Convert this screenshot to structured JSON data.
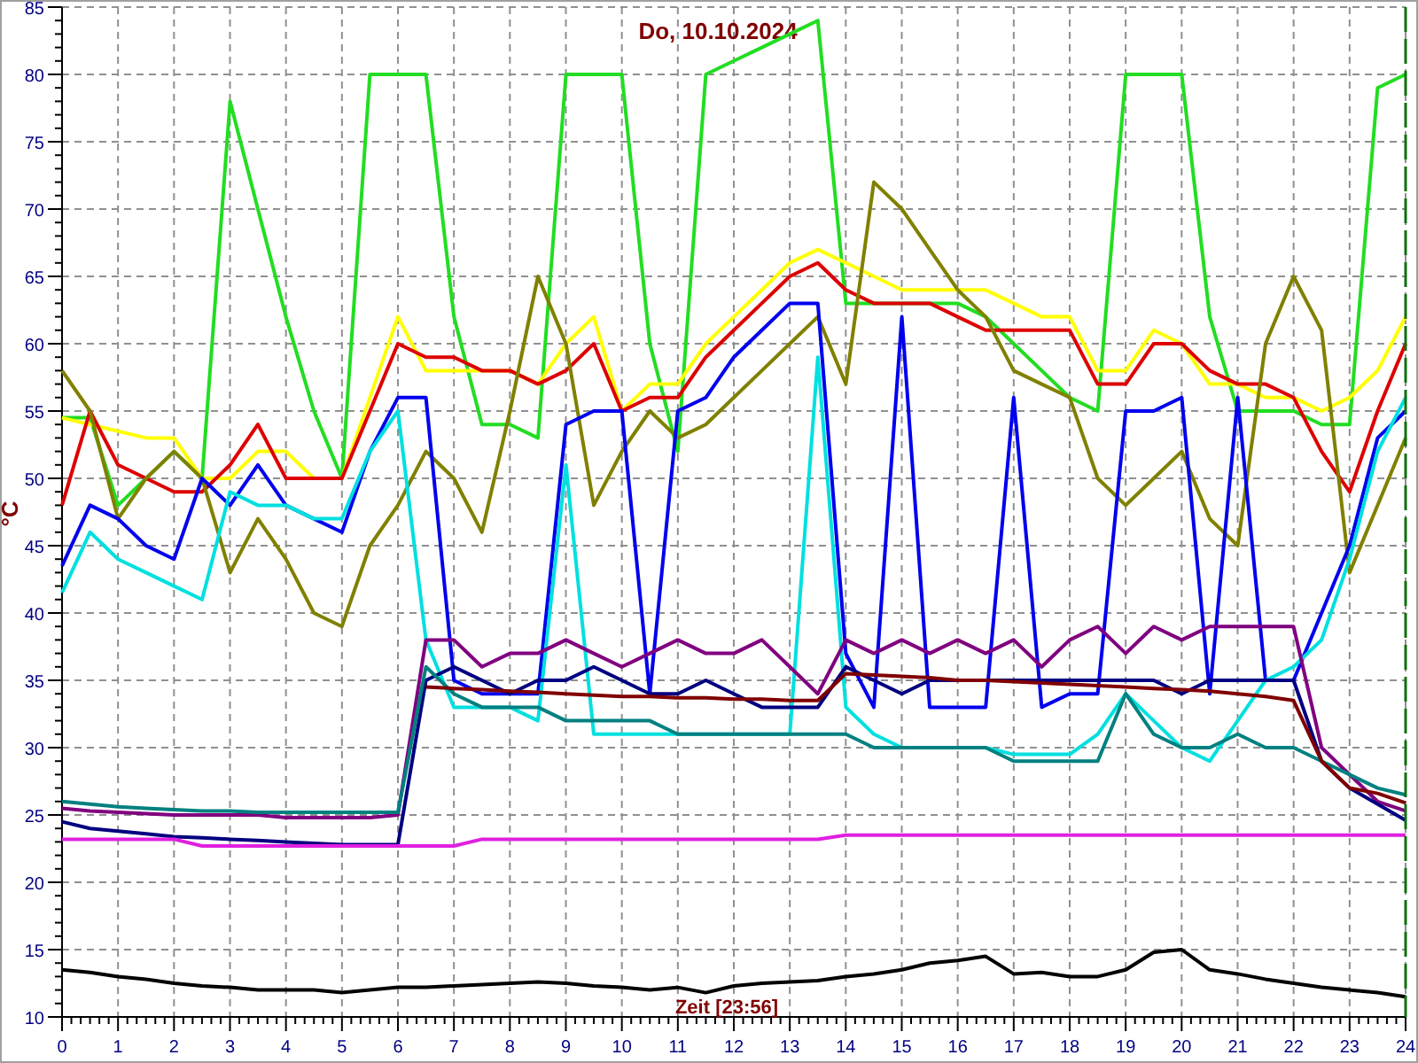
{
  "chart_data": {
    "type": "line",
    "title": "Do, 10.10.2024",
    "xlabel": "Zeit [23:56]",
    "ylabel": "°C",
    "x": [
      0,
      0.5,
      1,
      1.5,
      2,
      2.5,
      3,
      3.5,
      4,
      4.5,
      5,
      5.5,
      6,
      6.5,
      7,
      7.5,
      8,
      8.5,
      9,
      9.5,
      10,
      10.5,
      11,
      11.5,
      12,
      12.5,
      13,
      13.5,
      14,
      14.5,
      15,
      15.5,
      16,
      16.5,
      17,
      17.5,
      18,
      18.5,
      19,
      19.5,
      20,
      20.5,
      21,
      21.5,
      22,
      22.5,
      23,
      23.5,
      24
    ],
    "xlim": [
      0,
      24
    ],
    "ylim": [
      10,
      85
    ],
    "grid": true,
    "xticks": [
      0,
      1,
      2,
      3,
      4,
      5,
      6,
      7,
      8,
      9,
      10,
      11,
      12,
      13,
      14,
      15,
      16,
      17,
      18,
      19,
      20,
      21,
      22,
      23,
      24
    ],
    "yticks": [
      10,
      15,
      20,
      25,
      30,
      35,
      40,
      45,
      50,
      55,
      60,
      65,
      70,
      75,
      80,
      85
    ],
    "series": [
      {
        "color": "#22dd22",
        "values": [
          54.5,
          54.5,
          48,
          50,
          52,
          50,
          78,
          70,
          62,
          55,
          50,
          80,
          80,
          80,
          62,
          54,
          54,
          53,
          80,
          80,
          80,
          60,
          52,
          80,
          81,
          82,
          83,
          84,
          63,
          63,
          63,
          63,
          63,
          62,
          60,
          58,
          56,
          55,
          80,
          80,
          80,
          62,
          55,
          55,
          55,
          54,
          54,
          79,
          80
        ]
      },
      {
        "color": "#ffff00",
        "values": [
          54.5,
          54,
          53.5,
          53,
          53,
          50,
          50,
          52,
          52,
          50,
          50,
          56,
          62,
          58,
          58,
          58,
          58,
          57,
          60,
          62,
          55,
          57,
          57,
          60,
          62,
          64,
          66,
          67,
          66,
          65,
          64,
          64,
          64,
          64,
          63,
          62,
          62,
          58,
          58,
          61,
          60,
          57,
          57,
          56,
          56,
          55,
          56,
          58,
          62
        ]
      },
      {
        "color": "#dd0000",
        "values": [
          48,
          55,
          51,
          50,
          49,
          49,
          51,
          54,
          50,
          50,
          50,
          55,
          60,
          59,
          59,
          58,
          58,
          57,
          58,
          60,
          55,
          56,
          56,
          59,
          61,
          63,
          65,
          66,
          64,
          63,
          63,
          63,
          62,
          61,
          61,
          61,
          61,
          57,
          57,
          60,
          60,
          58,
          57,
          57,
          56,
          52,
          49,
          55,
          60
        ]
      },
      {
        "color": "#808000",
        "values": [
          58,
          55,
          47,
          50,
          52,
          50,
          43,
          47,
          44,
          40,
          39,
          45,
          48,
          52,
          50,
          46,
          55,
          65,
          60,
          48,
          52,
          55,
          53,
          54,
          56,
          58,
          60,
          62,
          57,
          72,
          70,
          67,
          64,
          62,
          58,
          57,
          56,
          50,
          48,
          50,
          52,
          47,
          45,
          60,
          65,
          61,
          43,
          48,
          53
        ]
      },
      {
        "color": "#0000ee",
        "values": [
          43.5,
          48,
          47,
          45,
          44,
          50,
          48,
          51,
          48,
          47,
          46,
          52,
          56,
          56,
          35,
          34,
          34,
          34,
          54,
          55,
          55,
          34,
          55,
          56,
          59,
          61,
          63,
          63,
          37,
          33,
          62,
          33,
          33,
          33,
          56,
          33,
          34,
          34,
          55,
          55,
          56,
          34,
          56,
          35,
          35,
          40,
          45,
          53,
          55
        ]
      },
      {
        "color": "#00e0e0",
        "values": [
          41.5,
          46,
          44,
          43,
          42,
          41,
          49,
          48,
          48,
          47,
          47,
          52,
          55,
          38,
          33,
          33,
          33,
          32,
          51,
          31,
          31,
          31,
          31,
          31,
          31,
          31,
          31,
          59,
          33,
          31,
          30,
          30,
          30,
          30,
          29.5,
          29.5,
          29.5,
          31,
          34,
          32,
          30,
          29,
          32,
          35,
          36,
          38,
          44,
          52,
          56
        ]
      },
      {
        "color": "#800080",
        "values": [
          25.5,
          25.3,
          25.2,
          25.1,
          25,
          25,
          25,
          25,
          24.8,
          24.8,
          24.8,
          24.8,
          25,
          38,
          38,
          36,
          37,
          37,
          38,
          37,
          36,
          37,
          38,
          37,
          37,
          38,
          36,
          34,
          38,
          37,
          38,
          37,
          38,
          37,
          38,
          36,
          38,
          39,
          37,
          39,
          38,
          39,
          39,
          39,
          39,
          30,
          28,
          26,
          25.3
        ]
      },
      {
        "color": "#000080",
        "values": [
          24.5,
          24,
          23.8,
          23.6,
          23.4,
          23.3,
          23.2,
          23.1,
          23,
          22.9,
          22.8,
          22.8,
          22.8,
          35,
          36,
          35,
          34,
          35,
          35,
          36,
          35,
          34,
          34,
          35,
          34,
          33,
          33,
          33,
          36,
          35,
          34,
          35,
          35,
          35,
          35,
          35,
          35,
          35,
          35,
          35,
          34,
          35,
          35,
          35,
          35,
          29,
          27,
          25.8,
          24.6
        ]
      },
      {
        "color": "#008080",
        "values": [
          26,
          25.8,
          25.6,
          25.5,
          25.4,
          25.3,
          25.3,
          25.2,
          25.2,
          25.2,
          25.2,
          25.2,
          25.2,
          36,
          34,
          33,
          33,
          33,
          32,
          32,
          32,
          32,
          31,
          31,
          31,
          31,
          31,
          31,
          31,
          30,
          30,
          30,
          30,
          30,
          29,
          29,
          29,
          29,
          34,
          31,
          30,
          30,
          31,
          30,
          30,
          29,
          28,
          27,
          26.5
        ]
      },
      {
        "color": "#800000",
        "values": [
          null,
          null,
          null,
          null,
          null,
          null,
          null,
          null,
          null,
          null,
          null,
          null,
          null,
          34.5,
          34.4,
          34.3,
          34.2,
          34.1,
          34,
          33.9,
          33.8,
          33.8,
          33.7,
          33.7,
          33.6,
          33.6,
          33.5,
          33.5,
          35.5,
          35.4,
          35.3,
          35.2,
          35,
          35,
          34.9,
          34.8,
          34.7,
          34.6,
          34.5,
          34.4,
          34.3,
          34.2,
          34,
          33.8,
          33.5,
          29,
          27,
          26.6,
          25.9
        ]
      },
      {
        "color": "#e020e0",
        "values": [
          23.2,
          23.2,
          23.2,
          23.2,
          23.2,
          22.7,
          22.7,
          22.7,
          22.7,
          22.7,
          22.7,
          22.7,
          22.7,
          22.7,
          22.7,
          23.2,
          23.2,
          23.2,
          23.2,
          23.2,
          23.2,
          23.2,
          23.2,
          23.2,
          23.2,
          23.2,
          23.2,
          23.2,
          23.5,
          23.5,
          23.5,
          23.5,
          23.5,
          23.5,
          23.5,
          23.5,
          23.5,
          23.5,
          23.5,
          23.5,
          23.5,
          23.5,
          23.5,
          23.5,
          23.5,
          23.5,
          23.5,
          23.5,
          23.5
        ]
      },
      {
        "color": "#000000",
        "values": [
          13.5,
          13.3,
          13,
          12.8,
          12.5,
          12.3,
          12.2,
          12,
          12,
          12,
          11.8,
          12,
          12.2,
          12.2,
          12.3,
          12.4,
          12.5,
          12.6,
          12.5,
          12.3,
          12.2,
          12,
          12.2,
          11.8,
          12.3,
          12.5,
          12.6,
          12.7,
          13,
          13.2,
          13.5,
          14,
          14.2,
          14.5,
          13.2,
          13.3,
          13,
          13,
          13.5,
          14.8,
          15,
          13.5,
          13.2,
          12.8,
          12.5,
          12.2,
          12,
          11.8,
          11.5
        ]
      }
    ]
  }
}
